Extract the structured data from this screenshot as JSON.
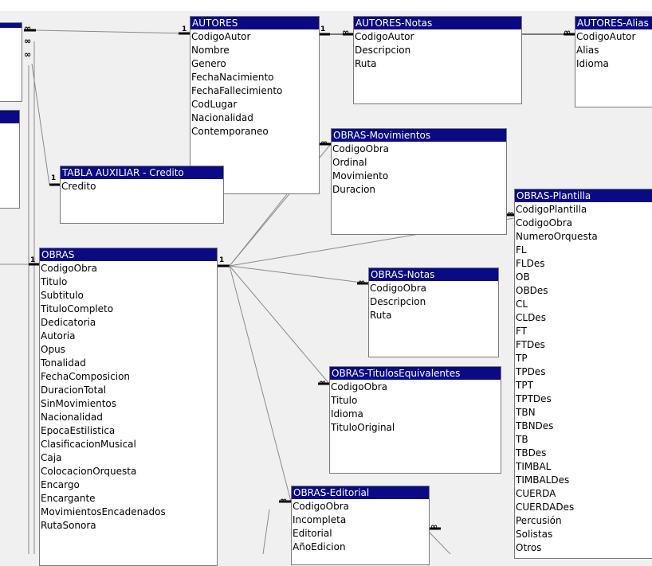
{
  "tables": {
    "autores": {
      "title": "AUTORES",
      "fields": [
        "CodigoAutor",
        "Nombre",
        "Genero",
        "FechaNacimiento",
        "FechaFallecimiento",
        "CodLugar",
        "Nacionalidad",
        "Contemporaneo"
      ]
    },
    "autores_notas": {
      "title": "AUTORES-Notas",
      "fields": [
        "CodigoAutor",
        "Descripcion",
        "Ruta"
      ]
    },
    "autores_alias": {
      "title": "AUTORES-Alias",
      "fields": [
        "CodigoAutor",
        "Alias",
        "Idioma"
      ]
    },
    "tabla_aux_credito": {
      "title": "TABLA AUXILIAR - Credito",
      "fields": [
        "Credito"
      ]
    },
    "obras_movimientos": {
      "title": "OBRAS-Movimientos",
      "fields": [
        "CodigoObra",
        "Ordinal",
        "Movimiento",
        "Duracion"
      ]
    },
    "obras_plantilla": {
      "title": "OBRAS-Plantilla",
      "fields": [
        "CodigoPlantilla",
        "CodigoObra",
        "NumeroOrquesta",
        "FL",
        "FLDes",
        "OB",
        "OBDes",
        "CL",
        "CLDes",
        "FT",
        "FTDes",
        "TP",
        "TPDes",
        "TPT",
        "TPTDes",
        "TBN",
        "TBNDes",
        "TB",
        "TBDes",
        "TIMBAL",
        "TIMBALDes",
        "CUERDA",
        "CUERDADes",
        "Percusión",
        "Solistas",
        "Otros"
      ]
    },
    "obras": {
      "title": "OBRAS",
      "fields": [
        "CodigoObra",
        "Titulo",
        "Subtitulo",
        "TituloCompleto",
        "Dedicatoria",
        "Autoria",
        "Opus",
        "Tonalidad",
        "FechaComposicion",
        "DuracionTotal",
        "SinMovimientos",
        "Nacionalidad",
        "EpocaEstilistica",
        "ClasificacionMusical",
        "Caja",
        "ColocacionOrquesta",
        "Encargo",
        "Encargante",
        "MovimientosEncadenados",
        "RutaSonora"
      ]
    },
    "obras_notas": {
      "title": "OBRAS-Notas",
      "fields": [
        "CodigoObra",
        "Descripcion",
        "Ruta"
      ]
    },
    "obras_titulos": {
      "title": "OBRAS-TitulosEquivalentes",
      "fields": [
        "CodigoObra",
        "Titulo",
        "Idioma",
        "TituloOriginal"
      ]
    },
    "obras_editorial": {
      "title": "OBRAS-Editorial",
      "fields": [
        "CodigoObra",
        "Incompleta",
        "Editorial",
        "AñoEdicion"
      ]
    }
  },
  "cardinality": {
    "one": "1",
    "many": "∞"
  }
}
